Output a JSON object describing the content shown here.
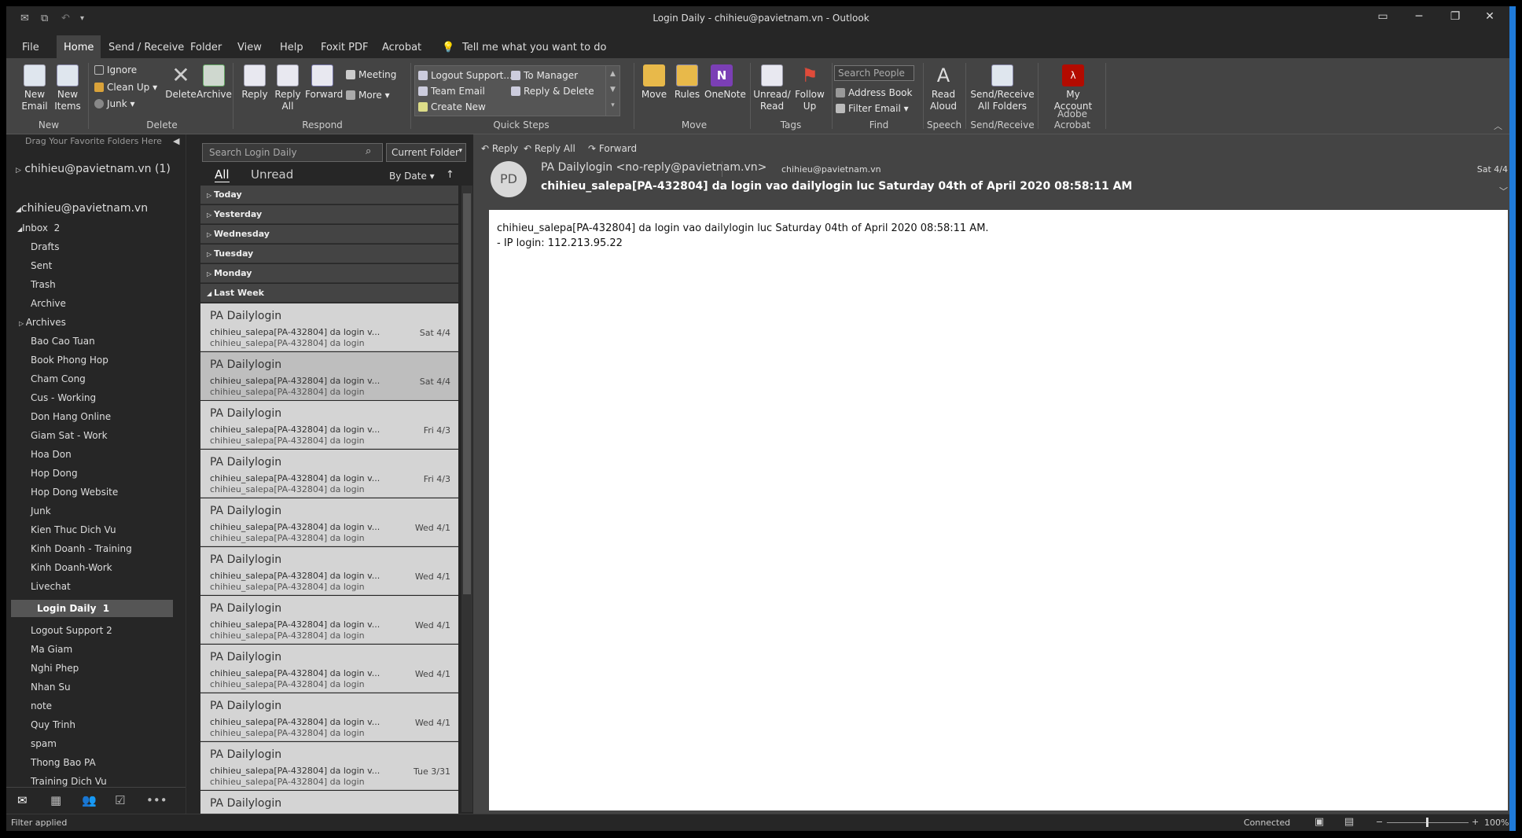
{
  "window": {
    "title": "Login Daily - chihieu@pavietnam.vn  -  Outlook"
  },
  "ribbon_tabs": [
    "File",
    "Home",
    "Send / Receive",
    "Folder",
    "View",
    "Help",
    "Foxit PDF",
    "Acrobat"
  ],
  "tell_me": "Tell me what you want to do",
  "ribbon": {
    "new": {
      "new_email": "New Email",
      "new_items": "New Items",
      "label": "New"
    },
    "delete": {
      "ignore": "Ignore",
      "clean_up": "Clean Up",
      "junk": "Junk",
      "delete": "Delete",
      "archive": "Archive",
      "label": "Delete"
    },
    "respond": {
      "reply": "Reply",
      "reply_all": "Reply All",
      "forward": "Forward",
      "meeting": "Meeting",
      "more": "More",
      "label": "Respond"
    },
    "quick_steps": {
      "items": [
        "Logout Support...",
        "To Manager",
        "Team Email",
        "Reply & Delete",
        "Create New"
      ],
      "label": "Quick Steps"
    },
    "move": {
      "move": "Move",
      "rules": "Rules",
      "onenote": "OneNote",
      "label": "Move"
    },
    "tags": {
      "unread_read": "Unread/ Read",
      "follow_up": "Follow Up",
      "label": "Tags"
    },
    "find": {
      "search_people": "Search People",
      "address_book": "Address Book",
      "filter_email": "Filter Email",
      "label": "Find"
    },
    "speech": {
      "read_aloud": "Read Aloud",
      "label": "Speech"
    },
    "send_receive": {
      "all_folders": "Send/Receive All Folders",
      "label": "Send/Receive"
    },
    "acrobat": {
      "my_account": "My Account",
      "label": "Adobe Acrobat"
    }
  },
  "folders": {
    "favorites_hint": "Drag Your Favorite Folders Here",
    "account_collapsed": "chihieu@pavietnam.vn (1)",
    "account": "chihieu@pavietnam.vn",
    "inbox": "Inbox",
    "inbox_count": "2",
    "items": [
      "Drafts",
      "Sent",
      "Trash",
      "Archive",
      "Archives",
      "Bao Cao Tuan",
      "Book Phong Hop",
      "Cham Cong",
      "Cus - Working",
      "Don Hang Online",
      "Giam Sat - Work",
      "Hoa Don",
      "Hop Dong",
      "Hop Dong Website",
      "Junk",
      "Kien Thuc Dich Vu",
      "Kinh Doanh - Training",
      "Kinh Doanh-Work",
      "Livechat"
    ],
    "selected": "Login Daily",
    "selected_count": "1",
    "items2": [
      "Logout Support  2",
      "Ma Giam",
      "Nghi Phep",
      "Nhan Su",
      "note",
      "Quy Trinh",
      "spam",
      "Thong Bao PA",
      "Training Dich Vu"
    ]
  },
  "list": {
    "search_placeholder": "Search Login Daily",
    "scope": "Current Folder",
    "tab_all": "All",
    "tab_unread": "Unread",
    "sort": "By Date",
    "groups": [
      "Today",
      "Yesterday",
      "Wednesday",
      "Tuesday",
      "Monday",
      "Last Week"
    ],
    "messages": [
      {
        "sender": "PA Dailylogin",
        "preview": "chihieu_salepa[PA-432804] da login v...",
        "preview2": "chihieu_salepa[PA-432804] da login",
        "date": "Sat 4/4"
      },
      {
        "sender": "PA Dailylogin",
        "preview": "chihieu_salepa[PA-432804] da login v...",
        "preview2": "chihieu_salepa[PA-432804] da login",
        "date": "Sat 4/4"
      },
      {
        "sender": "PA Dailylogin",
        "preview": "chihieu_salepa[PA-432804] da login v...",
        "preview2": "chihieu_salepa[PA-432804] da login",
        "date": "Fri 4/3"
      },
      {
        "sender": "PA Dailylogin",
        "preview": "chihieu_salepa[PA-432804] da login v...",
        "preview2": "chihieu_salepa[PA-432804] da login",
        "date": "Fri 4/3"
      },
      {
        "sender": "PA Dailylogin",
        "preview": "chihieu_salepa[PA-432804] da login v...",
        "preview2": "chihieu_salepa[PA-432804] da login",
        "date": "Wed 4/1"
      },
      {
        "sender": "PA Dailylogin",
        "preview": "chihieu_salepa[PA-432804] da login v...",
        "preview2": "chihieu_salepa[PA-432804] da login",
        "date": "Wed 4/1"
      },
      {
        "sender": "PA Dailylogin",
        "preview": "chihieu_salepa[PA-432804] da login v...",
        "preview2": "chihieu_salepa[PA-432804] da login",
        "date": "Wed 4/1"
      },
      {
        "sender": "PA Dailylogin",
        "preview": "chihieu_salepa[PA-432804] da login v...",
        "preview2": "chihieu_salepa[PA-432804] da login",
        "date": "Wed 4/1"
      },
      {
        "sender": "PA Dailylogin",
        "preview": "chihieu_salepa[PA-432804] da login v...",
        "preview2": "chihieu_salepa[PA-432804] da login",
        "date": "Wed 4/1"
      },
      {
        "sender": "PA Dailylogin",
        "preview": "chihieu_salepa[PA-432804] da login v...",
        "preview2": "chihieu_salepa[PA-432804] da login",
        "date": "Tue 3/31"
      },
      {
        "sender": "PA Dailylogin",
        "preview": "",
        "preview2": "",
        "date": ""
      }
    ]
  },
  "reading": {
    "reply": "Reply",
    "reply_all": "Reply All",
    "forward": "Forward",
    "avatar": "PD",
    "from": "PA Dailylogin <no-reply@pavietnam.vn>",
    "to": "chihieu@pavietnam.vn",
    "date": "Sat 4/4",
    "subject": "chihieu_salepa[PA-432804] da login vao dailylogin luc Saturday 04th of April 2020 08:58:11 AM",
    "body_line1": "chihieu_salepa[PA-432804] da login vao dailylogin luc Saturday 04th of April 2020 08:58:11 AM.",
    "body_line2": "- IP login: 112.213.95.22"
  },
  "status": {
    "filter": "Filter applied",
    "connection": "Connected",
    "zoom": "100%"
  }
}
